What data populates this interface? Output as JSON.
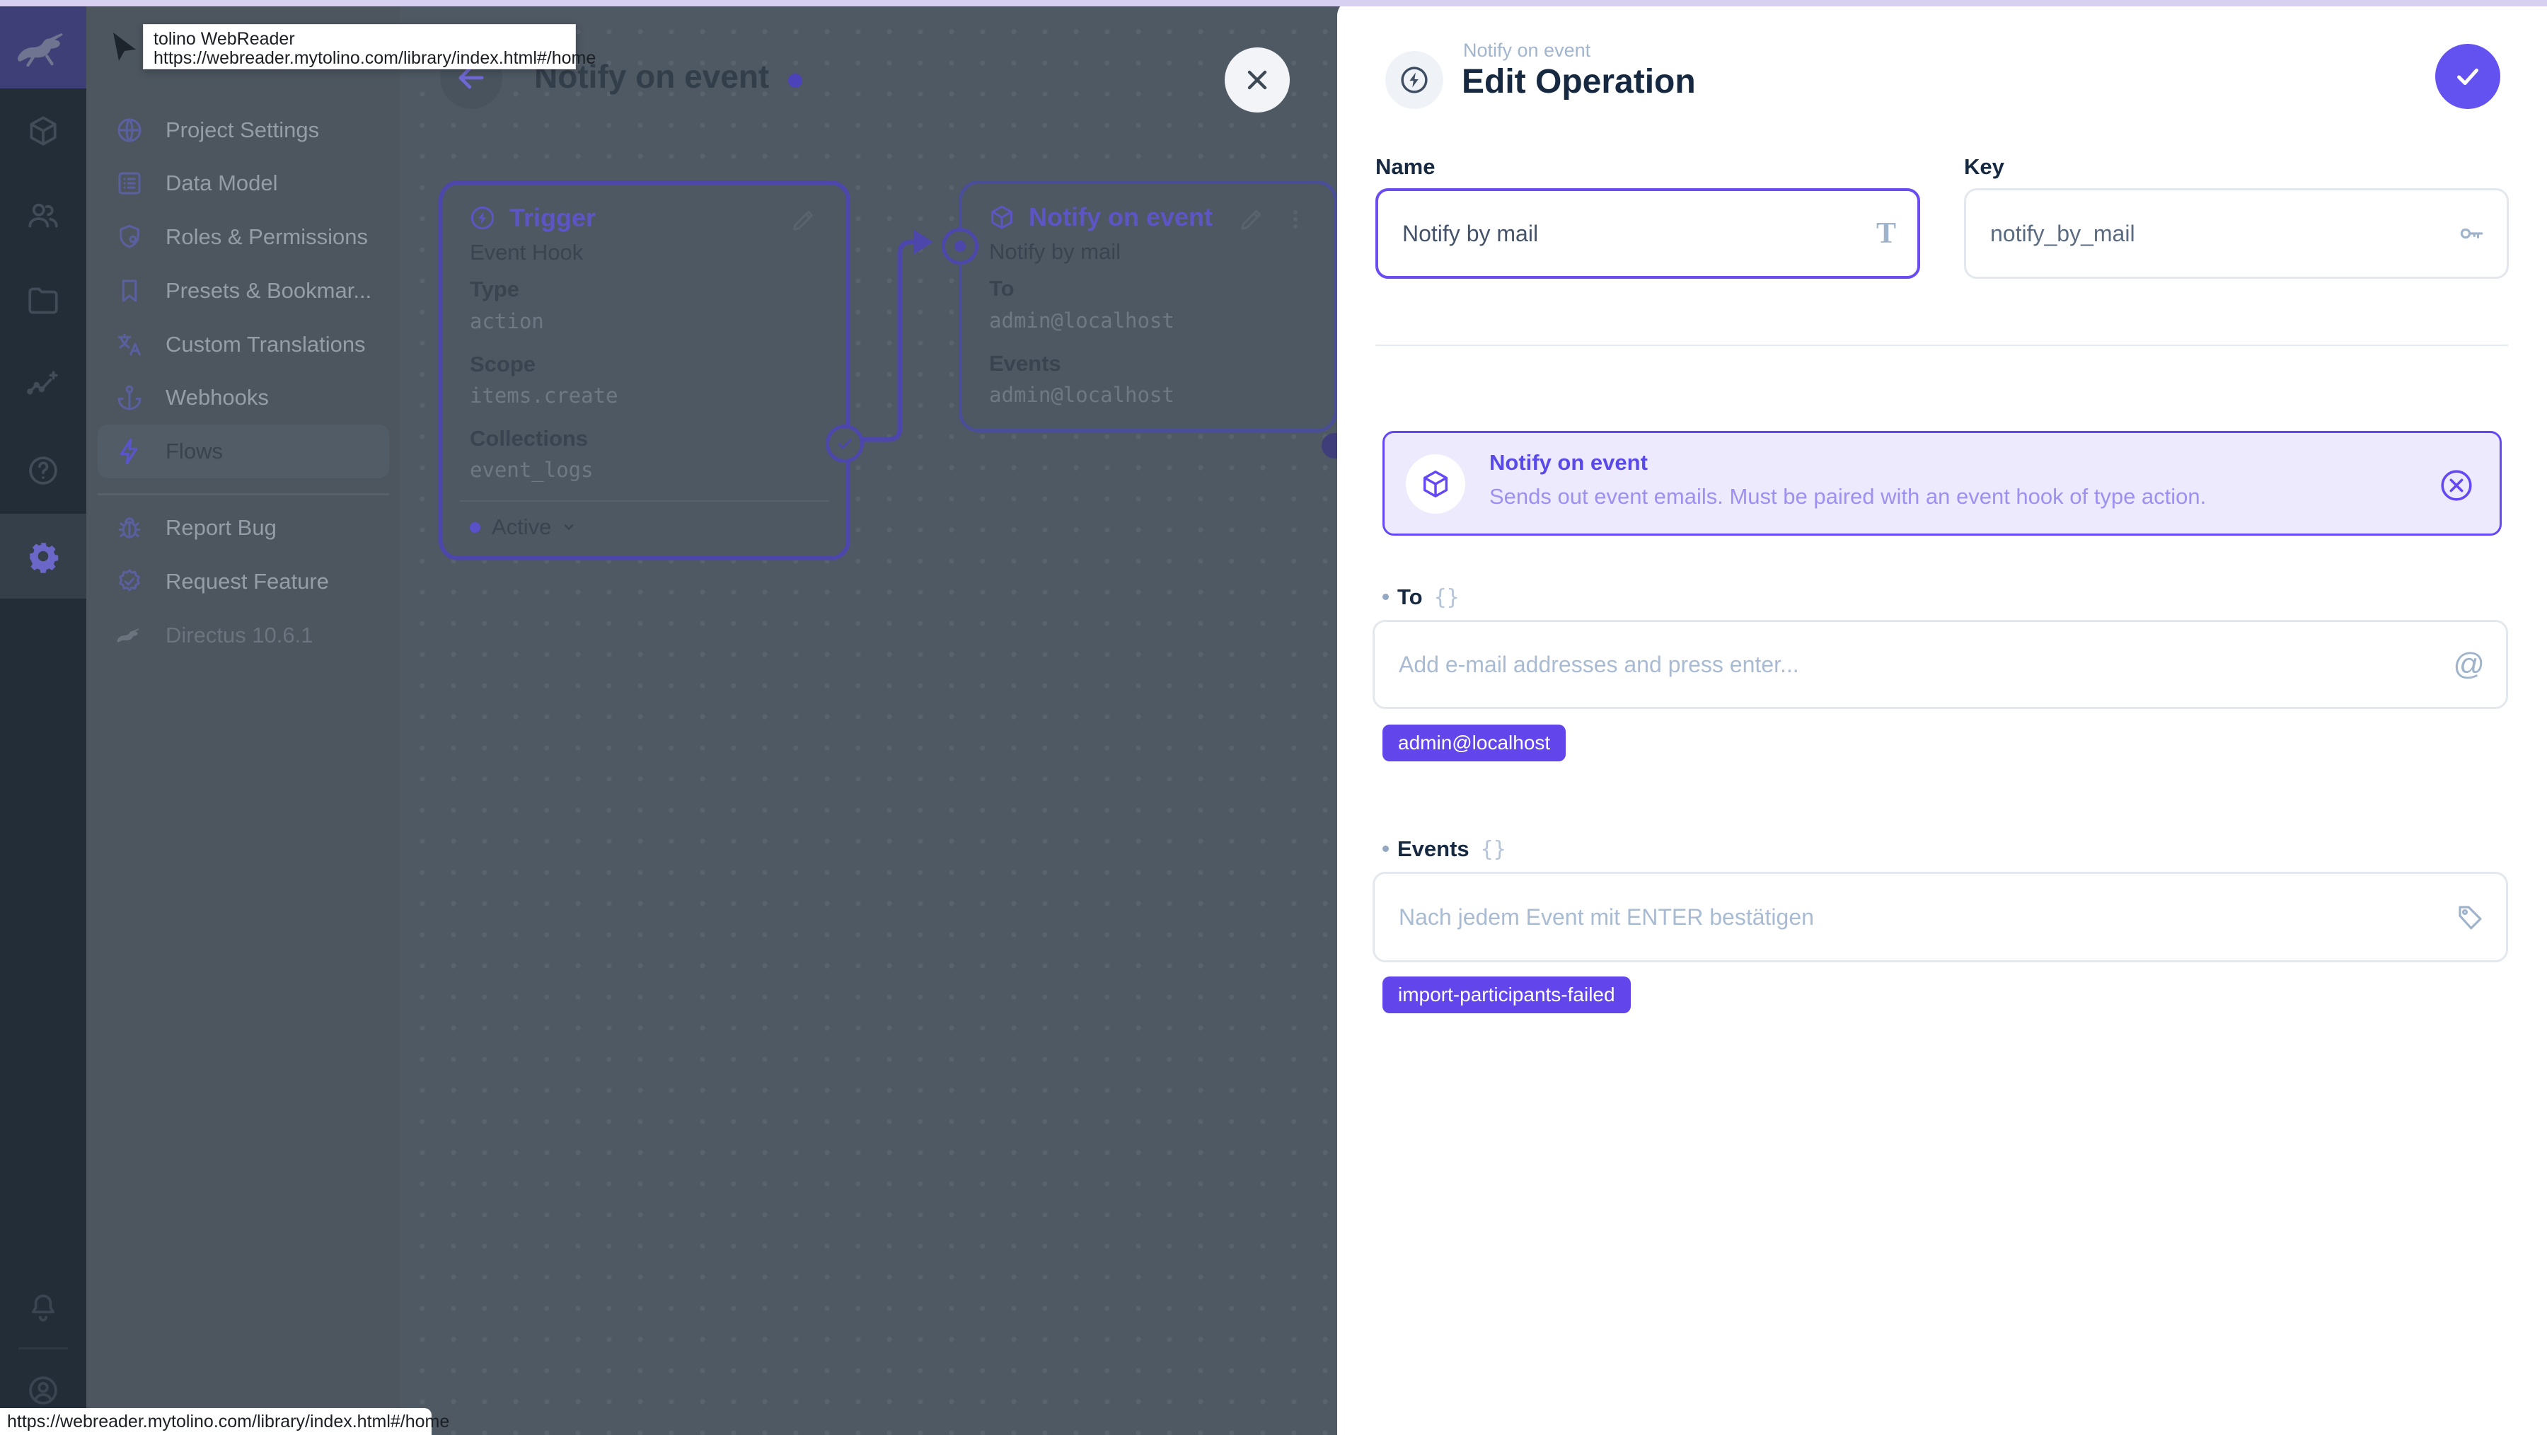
{
  "colors": {
    "accent": "#6644ff",
    "chip_bg": "#6246ec",
    "panel_bg": "#eeeafe",
    "panel_border": "#6447f5",
    "module_rail_bg": "#232d38",
    "nav_bg": "#4d565f",
    "canvas_bg": "#4f5963",
    "drawer_bg": "#ffffff",
    "top_strip": "#d8d0f0"
  },
  "tooltip": {
    "title": "tolino WebReader",
    "url": "https://webreader.mytolino.com/library/index.html#/home"
  },
  "status_bar": {
    "url": "https://webreader.mytolino.com/library/index.html#/home"
  },
  "module_bar": {
    "logo": "directus-rabbit",
    "items": [
      {
        "icon": "collections-box"
      },
      {
        "icon": "users"
      },
      {
        "icon": "files-folder"
      },
      {
        "icon": "insights-chart"
      },
      {
        "icon": "help"
      },
      {
        "icon": "settings-gear",
        "active": true
      },
      {
        "icon": "notifications-bell"
      },
      {
        "icon": "account-avatar"
      }
    ]
  },
  "nav": {
    "items": [
      {
        "label": "Project Settings",
        "icon": "globe"
      },
      {
        "label": "Data Model",
        "icon": "list"
      },
      {
        "label": "Roles & Permissions",
        "icon": "shield"
      },
      {
        "label": "Presets & Bookmar...",
        "icon": "bookmark"
      },
      {
        "label": "Custom Translations",
        "icon": "translate"
      },
      {
        "label": "Webhooks",
        "icon": "anchor"
      },
      {
        "label": "Flows",
        "icon": "bolt",
        "active": true
      },
      {
        "label": "Report Bug",
        "icon": "bug"
      },
      {
        "label": "Request Feature",
        "icon": "seal-check"
      }
    ],
    "version": "Directus 10.6.1"
  },
  "canvas": {
    "title": "Notify on event",
    "trigger_card": {
      "title": "Trigger",
      "name": "Event Hook",
      "fields": [
        {
          "label": "Type",
          "value": "action"
        },
        {
          "label": "Scope",
          "value": "items.create"
        },
        {
          "label": "Collections",
          "value": "event_logs"
        }
      ],
      "status": "Active"
    },
    "operation_card": {
      "title": "Notify on event",
      "name": "Notify by mail",
      "fields": [
        {
          "label": "To",
          "value": "admin@localhost"
        },
        {
          "label": "Events",
          "value": "admin@localhost"
        }
      ]
    }
  },
  "drawer": {
    "breadcrumb": "Notify on event",
    "title": "Edit Operation",
    "name_field": {
      "label": "Name",
      "value": "Notify by mail"
    },
    "key_field": {
      "label": "Key",
      "value": "notify_by_mail"
    },
    "panel": {
      "title": "Notify on event",
      "description": "Sends out event emails. Must be paired with an event hook of type action."
    },
    "to_field": {
      "label": "To",
      "placeholder": "Add e-mail addresses and press enter...",
      "chips": [
        "admin@localhost"
      ]
    },
    "events_field": {
      "label": "Events",
      "placeholder": "Nach jedem Event mit ENTER bestätigen",
      "chips": [
        "import-participants-failed"
      ]
    }
  }
}
